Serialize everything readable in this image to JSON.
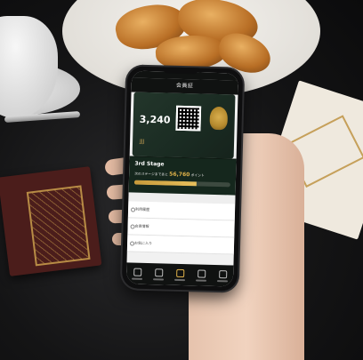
{
  "app": {
    "title": "会員証"
  },
  "member_card": {
    "points": "3,240",
    "logo_text": "JJJ"
  },
  "stage": {
    "title": "3rd Stage",
    "next_stage_prefix": "次のステージまであと",
    "points_needed": "56,760",
    "points_suffix": "ポイント",
    "progress_fraction": 0.65
  },
  "menu": {
    "items": [
      {
        "label": "利用履歴"
      },
      {
        "label": "会員情報"
      },
      {
        "label": "お気に入り"
      }
    ]
  },
  "tabbar": {
    "tabs": [
      {
        "icon": "megaphone-icon"
      },
      {
        "icon": "bag-icon"
      },
      {
        "icon": "card-icon",
        "active": true
      },
      {
        "icon": "person-icon"
      },
      {
        "icon": "menu-icon"
      }
    ]
  },
  "colors": {
    "card_green": "#1a2b22",
    "accent_gold": "#e0b24a",
    "dark_bar": "#101211"
  }
}
